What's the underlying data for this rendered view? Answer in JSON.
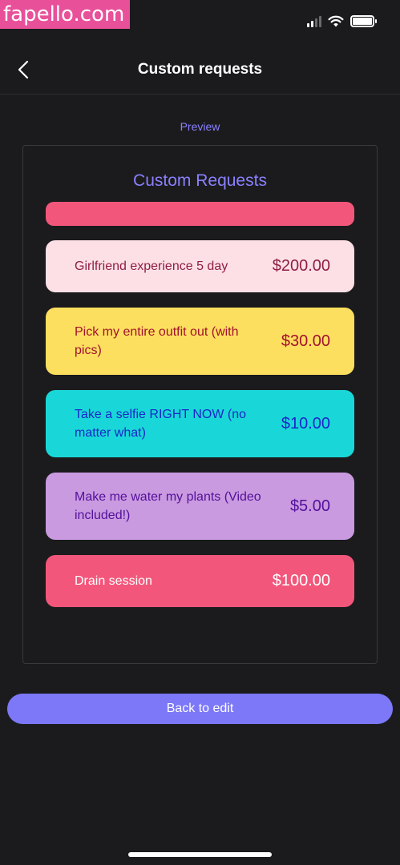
{
  "watermark": {
    "text": "fapello.com"
  },
  "nav": {
    "title": "Custom requests"
  },
  "preview": {
    "label": "Preview",
    "title": "Custom Requests",
    "items": [
      {
        "label": "Girlfriend experience 5 day",
        "price": "$200.00"
      },
      {
        "label": "Pick my entire outfit out (with pics)",
        "price": "$30.00"
      },
      {
        "label": "Take a selfie RIGHT NOW (no matter what)",
        "price": "$10.00"
      },
      {
        "label": "Make me water my plants (Video included!)",
        "price": "$5.00"
      },
      {
        "label": "Drain session",
        "price": "$100.00"
      }
    ]
  },
  "actions": {
    "back_to_edit": "Back to edit"
  },
  "colors": {
    "accent": "#7c78f8",
    "preview_text": "#8a80ff",
    "card_pink": "#fde0e6",
    "card_yellow": "#fddf5f",
    "card_cyan": "#19d7d8",
    "card_purple": "#c99ae0",
    "card_red": "#f2577b"
  },
  "icons": {
    "back": "chevron-left-icon",
    "signal": "cellular-signal-icon",
    "wifi": "wifi-icon",
    "battery": "battery-icon"
  }
}
